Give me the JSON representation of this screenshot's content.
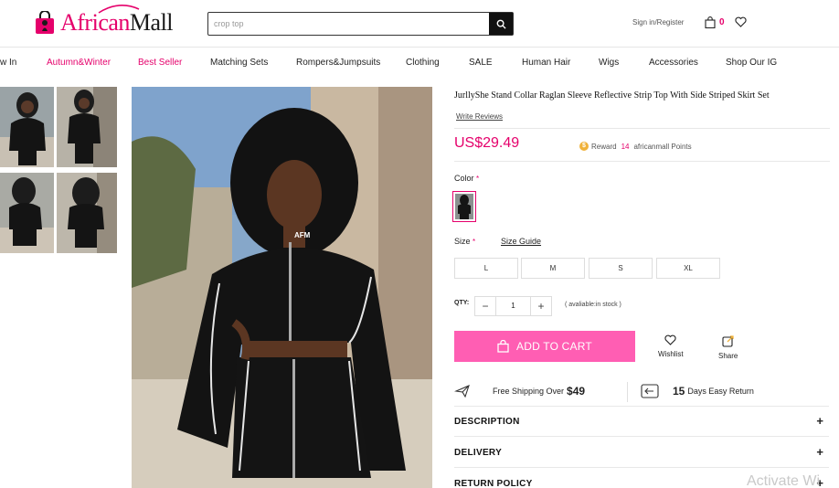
{
  "header": {
    "logo_prefix": "African",
    "logo_suffix": "Mall",
    "search_placeholder": "crop top",
    "signin_label": "Sign in/Register",
    "cart_count": "0"
  },
  "nav": {
    "items": [
      {
        "label": "w In"
      },
      {
        "label": "Autumn&Winter"
      },
      {
        "label": "Best Seller"
      },
      {
        "label": "Matching Sets"
      },
      {
        "label": "Rompers&Jumpsuits"
      },
      {
        "label": "Clothing"
      },
      {
        "label": "SALE"
      },
      {
        "label": "Human Hair"
      },
      {
        "label": "Wigs"
      },
      {
        "label": "Accessories"
      },
      {
        "label": "Shop Our IG"
      }
    ]
  },
  "product": {
    "title": "JurllyShe Stand Collar Raglan Sleeve Reflective Strip Top With Side Striped Skirt Set",
    "write_reviews": "Write Reviews",
    "price": "US$29.49",
    "reward_label": "Reward",
    "reward_points": "14",
    "reward_suffix": "africanmall Points",
    "color_label": "Color",
    "size_label": "Size",
    "required_mark": "*",
    "size_guide": "Size Guide",
    "sizes": [
      "L",
      "M",
      "S",
      "XL"
    ],
    "qty_label": "QTY:",
    "qty_minus": "−",
    "qty_value": "1",
    "qty_plus": "+",
    "stock_text": "( avaliable:in stock )",
    "add_to_cart": "ADD TO CART",
    "wishlist": "Wishlist",
    "share": "Share",
    "free_shipping_text": "Free Shipping Over",
    "free_shipping_amount": "$49",
    "return_days": "15",
    "return_text": "Days Easy Return"
  },
  "sections": [
    {
      "title": "DESCRIPTION",
      "toggle": "+"
    },
    {
      "title": "DELIVERY",
      "toggle": "+"
    },
    {
      "title": "RETURN POLICY",
      "toggle": "+"
    }
  ],
  "watermark": "Activate Wi",
  "colors": {
    "brand_pink": "#e5006b",
    "cart_button": "#ff5eb3",
    "coin": "#f0b23a"
  }
}
